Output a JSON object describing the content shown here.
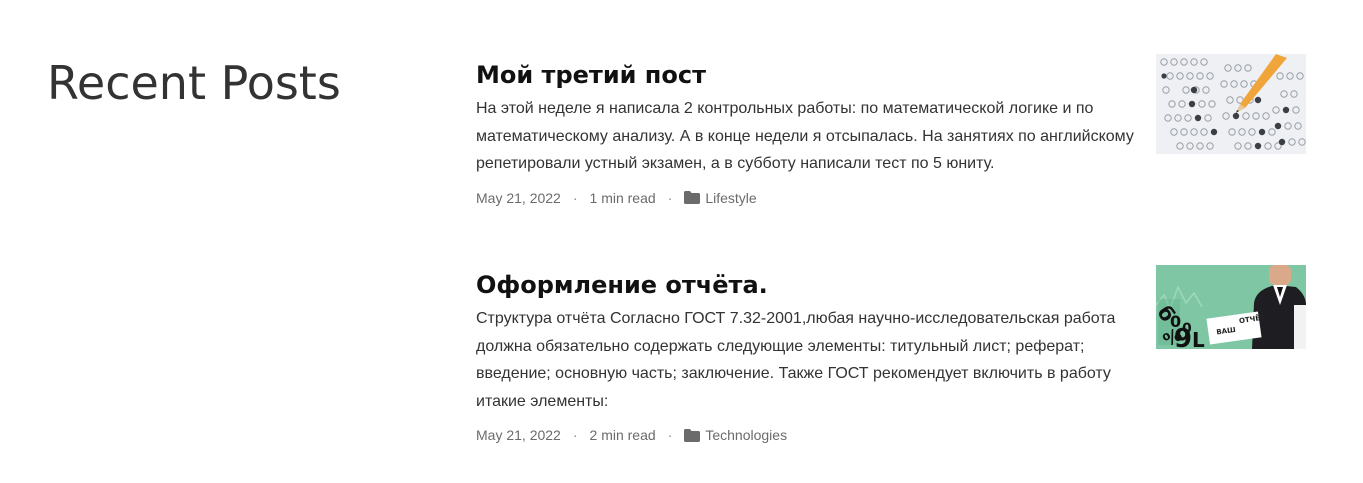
{
  "section": {
    "title": "Recent Posts"
  },
  "posts": [
    {
      "title": "Мой третий пост",
      "excerpt": "На этой неделе я написала 2 контрольных работы: по математической логике и по математическому анализу. А в конце недели я отсыпалась. На занятиях по английскому репетировали устный экзамен, а в субботу написали тест по 5 юниту.",
      "date": "May 21, 2022",
      "read_time": "1 min read",
      "category": "Lifestyle",
      "category_icon": "folder-icon",
      "thumbnail": "exam-answer-sheet-image"
    },
    {
      "title": "Оформление отчёта.",
      "excerpt": "Структура отчёта Согласно ГОСТ 7.32-2001,любая научно-исследовательская работа должна обязательно содержать следующие элементы: титульный лист; реферат; введение; основную часть; заключение. Также ГОСТ рекомендует включить в работу итакие элементы:",
      "date": "May 21, 2022",
      "read_time": "2 min read",
      "category": "Technologies",
      "category_icon": "folder-icon",
      "thumbnail": "report-presenter-image",
      "thumbnail_text": {
        "left": "ВАШ",
        "right": "ОТЧЁТ"
      }
    }
  ],
  "separator": "·",
  "colors": {
    "title": "#111111",
    "text": "#333333",
    "meta": "#6b6b6b",
    "thumb2_bg": "#7fc7a4"
  }
}
